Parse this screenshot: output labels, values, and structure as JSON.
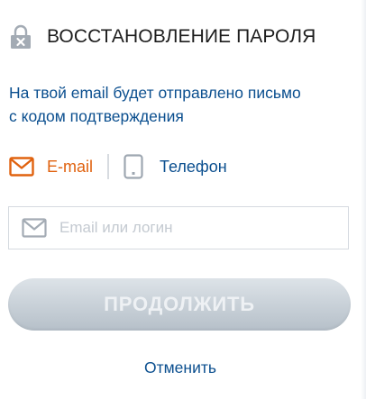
{
  "header": {
    "title": "ВОССТАНОВЛЕНИЕ ПАРОЛЯ",
    "icon": "lock-icon"
  },
  "description": {
    "line1": "На твой email будет отправлено письмо",
    "line2": "с кодом подтверждения"
  },
  "methods": {
    "email_label": "E-mail",
    "phone_label": "Телефон",
    "selected": "email"
  },
  "login_field": {
    "value": "",
    "placeholder": "Email или логин"
  },
  "continue_button": {
    "label": "ПРОДОЛЖИТЬ",
    "state": "disabled"
  },
  "cancel_link": {
    "label": "Отменить"
  },
  "colors": {
    "accent_orange": "#e0620f",
    "link_blue": "#0b4f8f",
    "title_text": "#1d1d1d",
    "button_disabled": "#c6ced5"
  }
}
